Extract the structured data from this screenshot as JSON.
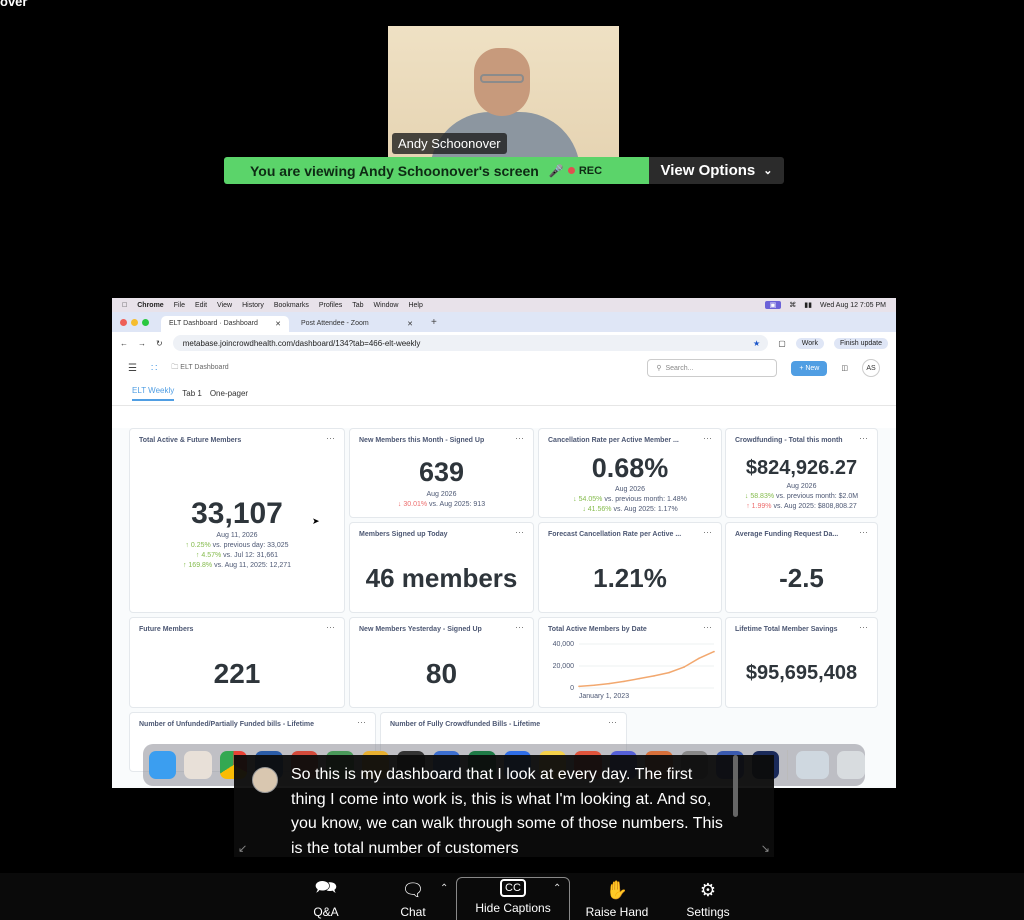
{
  "corner_title": "over",
  "speaker": {
    "name": "Andy Schoonover"
  },
  "banner": {
    "text": "You are viewing  Andy Schoonover's screen",
    "rec": "REC",
    "view_options": "View Options"
  },
  "mac_menu": {
    "app": "Chrome",
    "items": [
      "File",
      "Edit",
      "View",
      "History",
      "Bookmarks",
      "Profiles",
      "Tab",
      "Window",
      "Help"
    ],
    "clock": "Wed Aug 12  7:05 PM"
  },
  "browser": {
    "tabs": [
      "ELT Dashboard · Dashboard",
      "Post Attendee - Zoom"
    ],
    "url": "metabase.joincrowdhealth.com/dashboard/134?tab=466-elt-weekly",
    "profile": "Work",
    "finish_update": "Finish update"
  },
  "metabase": {
    "breadcrumb": "ELT Dashboard",
    "search_placeholder": "Search...",
    "new_label": "New",
    "avatar": "AS",
    "tabs": [
      "ELT Weekly",
      "Tab 1",
      "One-pager"
    ]
  },
  "cards": {
    "total_active": {
      "title": "Total Active & Future Members",
      "value": "33,107",
      "date": "Aug 11, 2026",
      "cmp": [
        {
          "dir": "up",
          "pct": "0.25%",
          "text": " vs. previous day: 33,025"
        },
        {
          "dir": "up",
          "pct": "4.57%",
          "text": " vs. Jul 12: 31,661"
        },
        {
          "dir": "up",
          "pct": "169.8%",
          "text": " vs. Aug 11, 2025: 12,271"
        }
      ]
    },
    "new_month": {
      "title": "New Members this Month - Signed Up",
      "value": "639",
      "date": "Aug 2026",
      "cmp": [
        {
          "dir": "dn",
          "pct": "30.01%",
          "text": " vs. Aug 2025: 913"
        }
      ]
    },
    "cancel_rate": {
      "title": "Cancellation Rate per Active Member ...",
      "value": "0.68%",
      "date": "Aug 2026",
      "cmp": [
        {
          "dir": "up",
          "pct": "54.05%",
          "text": " vs. previous month: 1.48%"
        },
        {
          "dir": "up",
          "pct": "41.56%",
          "text": " vs. Aug 2025: 1.17%"
        }
      ]
    },
    "crowdfunding": {
      "title": "Crowdfunding - Total this month",
      "value": "$824,926.27",
      "date": "Aug 2026",
      "cmp": [
        {
          "dir": "up",
          "pct": "58.83%",
          "text": " vs. previous month: $2.0M"
        },
        {
          "dir": "dn",
          "pct": "1.99%",
          "text": " vs. Aug 2025: $808,808.27"
        }
      ]
    },
    "signed_today": {
      "title": "Members Signed up Today",
      "value": "46 members"
    },
    "forecast_cancel": {
      "title": "Forecast Cancellation Rate per Active ...",
      "value": "1.21%"
    },
    "avg_funding": {
      "title": "Average Funding Request Da...",
      "value": "-2.5"
    },
    "future": {
      "title": "Future Members",
      "value": "221"
    },
    "new_yesterday": {
      "title": "New Members Yesterday - Signed Up",
      "value": "80"
    },
    "total_by_date": {
      "title": "Total Active Members by Date"
    },
    "lifetime_savings": {
      "title": "Lifetime Total Member Savings",
      "value": "$95,695,408"
    },
    "unfunded": {
      "title": "Number of Unfunded/Partially Funded bills - Lifetime"
    },
    "fully_funded": {
      "title": "Number of Fully Crowdfunded Bills - Lifetime"
    }
  },
  "chart_data": {
    "type": "line",
    "title": "Total Active Members by Date",
    "x": [
      "2022-07",
      "2023-01",
      "2023-07",
      "2024-01",
      "2024-07",
      "2025-01",
      "2025-07",
      "2026-01",
      "2026-04",
      "2026-08"
    ],
    "series": [
      {
        "values": [
          1500,
          2500,
          4000,
          6000,
          8500,
          11000,
          14000,
          19000,
          27000,
          33107
        ]
      }
    ],
    "x_tick_labels": [
      "January 1, 2023"
    ],
    "y_ticks": [
      "0",
      "20,000",
      "40,000"
    ],
    "ylim": [
      0,
      40000
    ],
    "color": "#f2a86f"
  },
  "captions": {
    "text": "So this is my dashboard that I look at every day. The first thing I come into work is, this is what I'm looking at. And so, you know, we can walk through some of those numbers. This is the total number of customers"
  },
  "toolbar": {
    "qa": "Q&A",
    "chat": "Chat",
    "captions": "Hide Captions",
    "raise": "Raise Hand",
    "settings": "Settings"
  }
}
